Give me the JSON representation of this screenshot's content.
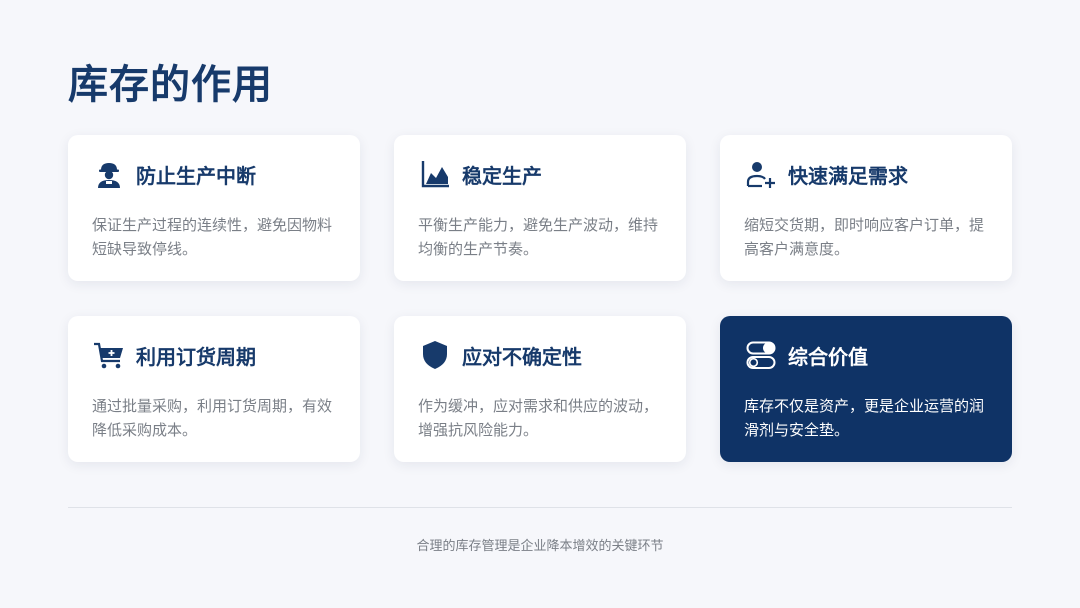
{
  "page": {
    "title": "库存的作用"
  },
  "cards": [
    {
      "icon": "worker-icon",
      "title": "防止生产中断",
      "desc": "保证生产过程的连续性，避免因物料短缺导致停线。"
    },
    {
      "icon": "area-chart-icon",
      "title": "稳定生产",
      "desc": "平衡生产能力，避免生产波动，维持均衡的生产节奏。"
    },
    {
      "icon": "add-user-icon",
      "title": "快速满足需求",
      "desc": "缩短交货期，即时响应客户订单，提高客户满意度。"
    },
    {
      "icon": "shopping-cart-icon",
      "title": "利用订货周期",
      "desc": "通过批量采购，利用订货周期，有效降低采购成本。"
    },
    {
      "icon": "shield-icon",
      "title": "应对不确定性",
      "desc": "作为缓冲，应对需求和供应的波动，增强抗风险能力。"
    },
    {
      "icon": "toggle-icon",
      "title": "综合价值",
      "desc": "库存不仅是资产，更是企业运营的润滑剂与安全垫。"
    }
  ],
  "footer": {
    "text": "合理的库存管理是企业降本增效的关键环节"
  },
  "colors": {
    "accent": "#173a6b",
    "highlight": "#0f3366",
    "background": "#f6f7fb"
  }
}
